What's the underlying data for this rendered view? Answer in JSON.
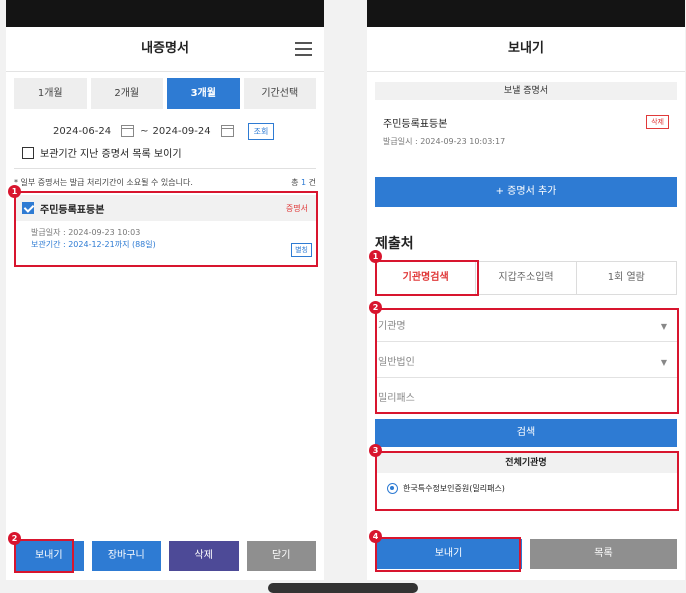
{
  "left_screen": {
    "title": "내증명서",
    "period_tabs": [
      "1개월",
      "2개월",
      "3개월",
      "기간선택"
    ],
    "active_tab": 2,
    "date_from": "2024-06-24",
    "date_separator": "~",
    "date_to": "2024-09-24",
    "lookup_label": "조회",
    "show_expired_label": "보관기간 지난 증명서 목록 보이기",
    "notice": "* 일부 증명서는 발급 처리기간이 소요될 수 있습니다.",
    "count_prefix": "총",
    "count_value": "1",
    "count_suffix": "건",
    "document": {
      "name": "주민등록표등본",
      "tag": "증명서",
      "issue_line": "발급일자 : 2024-09-23 10:03",
      "keep_line": "보관기간 : 2024-12-21까지 (88일)",
      "separate_label": "별칭"
    },
    "bottom_buttons": [
      "보내기",
      "장바구니",
      "삭제",
      "닫기"
    ],
    "badges": [
      "1",
      "2"
    ]
  },
  "right_screen": {
    "title": "보내기",
    "section_header": "보낼 증명서",
    "sent_doc_name": "주민등록표등본",
    "sent_doc_issue": "발급일시 : 2024-09-23 10:03:17",
    "delete_label": "삭제",
    "add_doc_label": "+ 증명서 추가",
    "submit_title": "제출처",
    "submit_tabs": [
      "기관명검색",
      "지갑주소입력",
      "1회 열람"
    ],
    "field_org_name": "기관명",
    "field_org_type": "일반법인",
    "field_milipass": "밀리패스",
    "search_label": "검색",
    "institution_header": "전체기관명",
    "institution_option": "한국특수정보인증원(밀리패스)",
    "bottom_buttons": [
      "보내기",
      "목록"
    ],
    "badges": [
      "1",
      "2",
      "3",
      "4"
    ]
  },
  "colors": {
    "accent_blue": "#2e7bd3",
    "annotation_red": "#d8152e",
    "navy_button": "#4d4a97",
    "gray_button": "#8f8f8f"
  }
}
